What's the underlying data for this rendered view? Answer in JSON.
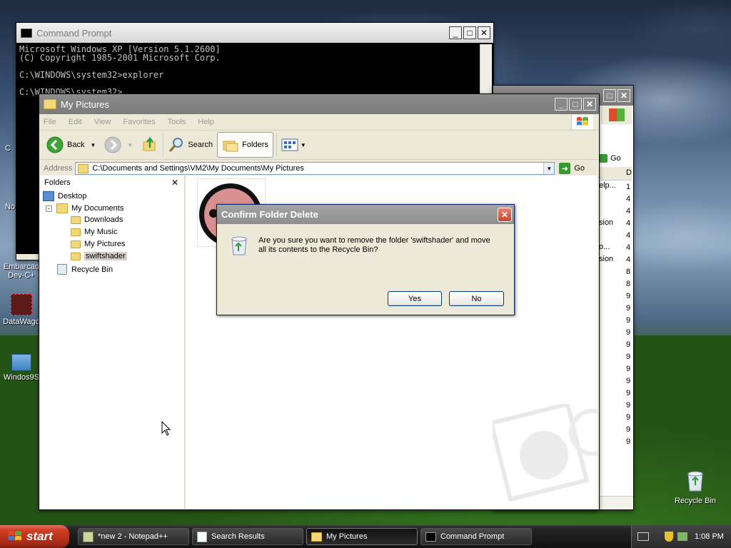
{
  "desktop": {
    "icons": [
      {
        "label_line1": "Embarcad",
        "label_line2": "Dev-C+"
      },
      {
        "label_line1": "DataWago",
        "label_line2": ""
      },
      {
        "label_line1": "Windos9S",
        "label_line2": ""
      },
      {
        "label_line1": "Recycle Bin",
        "label_line2": ""
      }
    ],
    "partial_texts": [
      "C",
      "No"
    ]
  },
  "cmd": {
    "title": "Command Prompt",
    "lines": [
      "Microsoft Windows XP [Version 5.1.2600]",
      "(C) Copyright 1985-2001 Microsoft Corp.",
      "",
      "C:\\WINDOWS\\system32>explorer",
      "",
      "C:\\WINDOWS\\system32>"
    ]
  },
  "bgexplorer": {
    "go_label": "Go",
    "col_header": "D",
    "list": [
      "elp...",
      "",
      "",
      "sion",
      "o...",
      "sion"
    ],
    "digits": [
      "1",
      "4",
      "4",
      "4",
      "4",
      "4",
      "4",
      "8",
      "8",
      "9",
      "9",
      "9",
      "9",
      "9",
      "9",
      "9",
      "9",
      "9",
      "9",
      "9",
      "9",
      "9"
    ]
  },
  "explorer": {
    "title": "My Pictures",
    "menu": [
      "File",
      "Edit",
      "View",
      "Favorites",
      "Tools",
      "Help"
    ],
    "toolbar": {
      "back": "Back",
      "search": "Search",
      "folders": "Folders"
    },
    "address_label": "Address",
    "address": "C:\\Documents and Settings\\VM2\\My Documents\\My Pictures",
    "go_label": "Go",
    "folders_pane_title": "Folders",
    "tree": [
      {
        "label": "Desktop",
        "level": 0,
        "icon": "desktop-icon"
      },
      {
        "label": "My Documents",
        "level": 1,
        "icon": "my-documents-icon"
      },
      {
        "label": "Downloads",
        "level": 2,
        "icon": "folder-icon"
      },
      {
        "label": "My Music",
        "level": 2,
        "icon": "folder-icon"
      },
      {
        "label": "My Pictures",
        "level": 2,
        "icon": "folder-icon"
      },
      {
        "label": "swiftshader",
        "level": 2,
        "icon": "folder-icon",
        "selected": true
      },
      {
        "label": "Recycle Bin",
        "level": 1,
        "icon": "recycle-bin-icon"
      }
    ]
  },
  "dialog": {
    "title": "Confirm Folder Delete",
    "message_line1": "Are you sure you want to remove the folder 'swiftshader' and move",
    "message_line2": "all its contents to the Recycle Bin?",
    "yes_label": "Yes",
    "no_label": "No"
  },
  "taskbar": {
    "start_label": "start",
    "tasks": [
      {
        "label": "*new 2 - Notepad++",
        "icon": "notepad-icon",
        "active": false
      },
      {
        "label": "Search Results",
        "icon": "search-results-icon",
        "active": false
      },
      {
        "label": "My Pictures",
        "icon": "folder-icon",
        "active": true
      },
      {
        "label": "Command Prompt",
        "icon": "cmd-icon",
        "active": false
      }
    ],
    "clock": "1:08 PM"
  },
  "colors": {
    "selection": "#316ac5",
    "title_inactive": "#808080",
    "xp_close_red": "#c9452c"
  }
}
